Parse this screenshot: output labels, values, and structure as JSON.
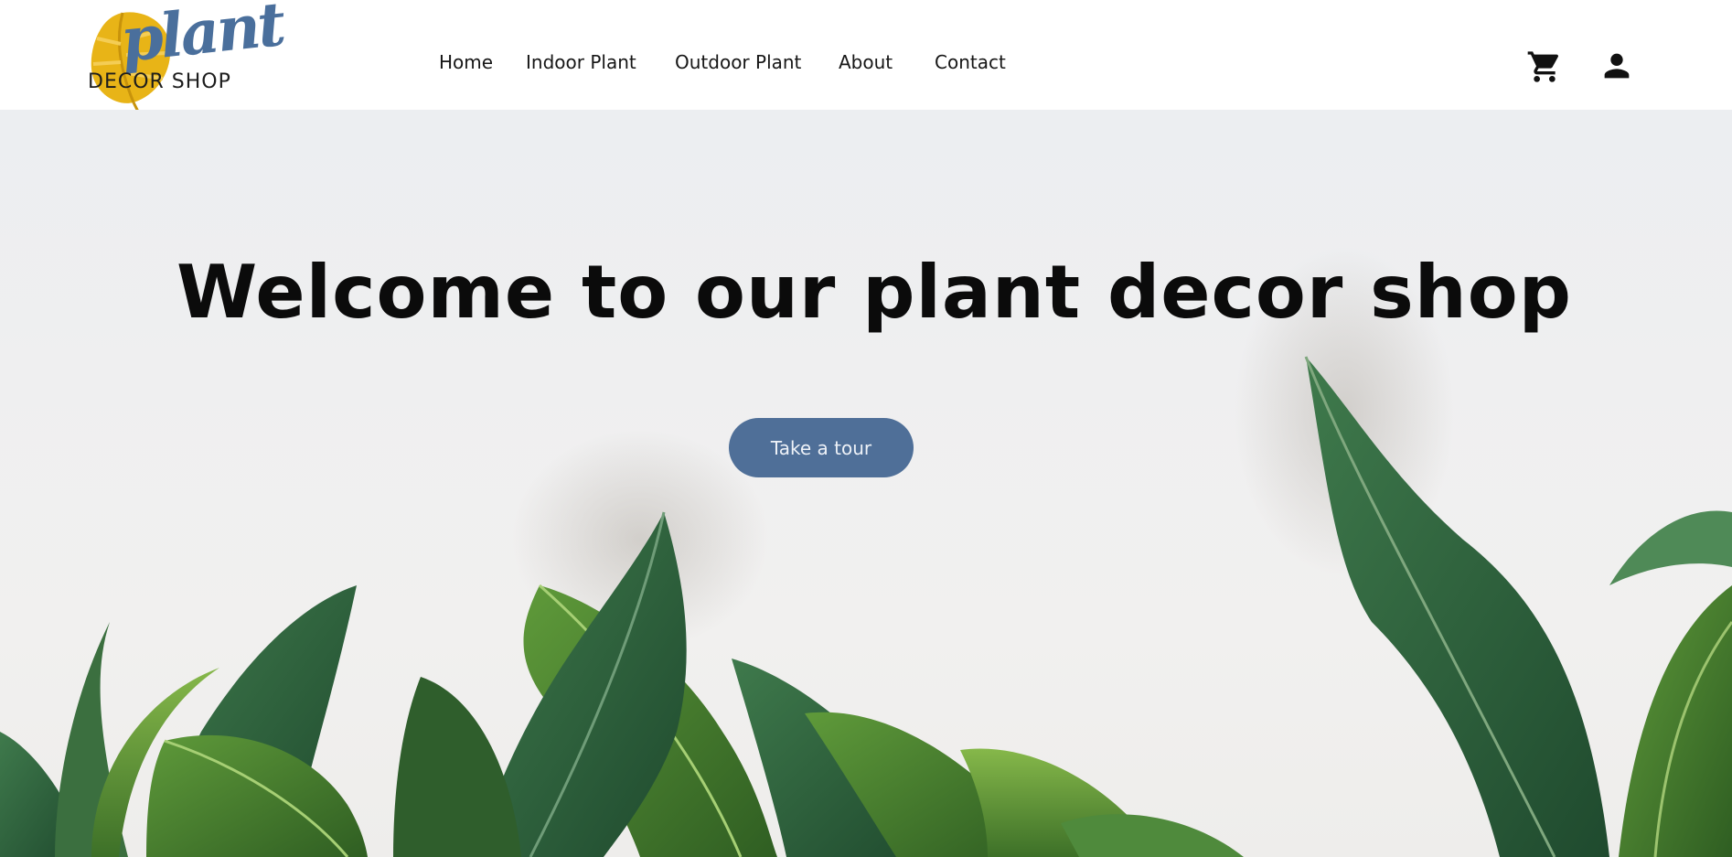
{
  "brand": {
    "logo_script": "plant",
    "logo_sub": "DECOR SHOP",
    "colors": {
      "leaf_gold": "#e8b417",
      "script_blue": "#4a6f9c"
    }
  },
  "nav": {
    "items": [
      {
        "label": "Home"
      },
      {
        "label": "Indoor Plant"
      },
      {
        "label": "Outdoor Plant"
      },
      {
        "label": "About"
      },
      {
        "label": "Contact"
      }
    ]
  },
  "header_icons": {
    "cart": "cart-icon",
    "account": "user-icon"
  },
  "hero": {
    "title": "Welcome to our plant decor shop",
    "button_label": "Take a tour",
    "colors": {
      "button_bg": "#4f6f98",
      "button_text": "#eef2f8",
      "background": "#eeeff0"
    }
  }
}
